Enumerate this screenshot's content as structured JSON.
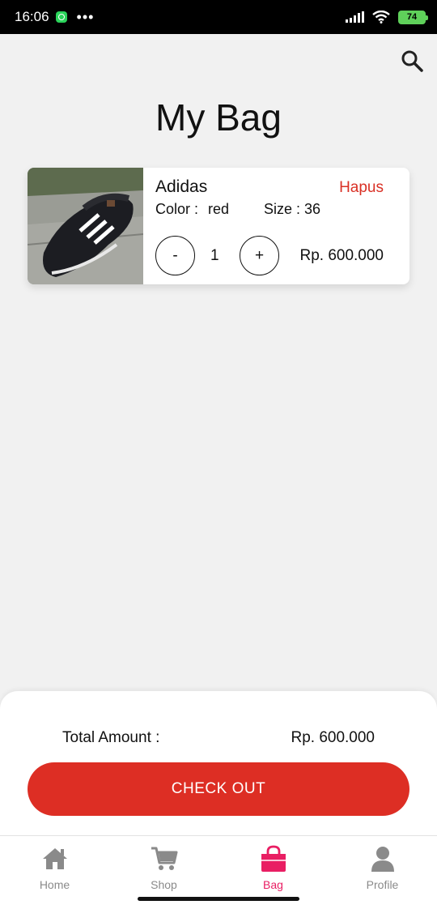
{
  "status_bar": {
    "time": "16:06",
    "dots": "•••",
    "battery": "74",
    "icons": [
      "whatsapp-icon",
      "signal-icon",
      "wifi-icon",
      "battery-icon"
    ]
  },
  "header": {
    "title": "My Bag",
    "search_icon": "search-icon"
  },
  "cart": {
    "items": [
      {
        "name": "Adidas",
        "delete_label": "Hapus",
        "color_label": "Color :",
        "color_value": "red",
        "size_label": "Size : 36",
        "quantity": "1",
        "minus_label": "-",
        "plus_label": "+",
        "price": "Rp. 600.000"
      }
    ]
  },
  "summary": {
    "total_label": "Total Amount :",
    "total_value": "Rp. 600.000",
    "checkout_label": "CHECK OUT"
  },
  "nav": {
    "items": [
      {
        "label": "Home",
        "icon": "home-icon",
        "active": false
      },
      {
        "label": "Shop",
        "icon": "cart-icon",
        "active": false
      },
      {
        "label": "Bag",
        "icon": "bag-icon",
        "active": true
      },
      {
        "label": "Profile",
        "icon": "user-icon",
        "active": false
      }
    ]
  },
  "colors": {
    "accent_red": "#dd2e24",
    "delete_red": "#d93025",
    "nav_active": "#e91e63",
    "nav_inactive": "#8a8a8a",
    "background": "#f1f1f1"
  }
}
